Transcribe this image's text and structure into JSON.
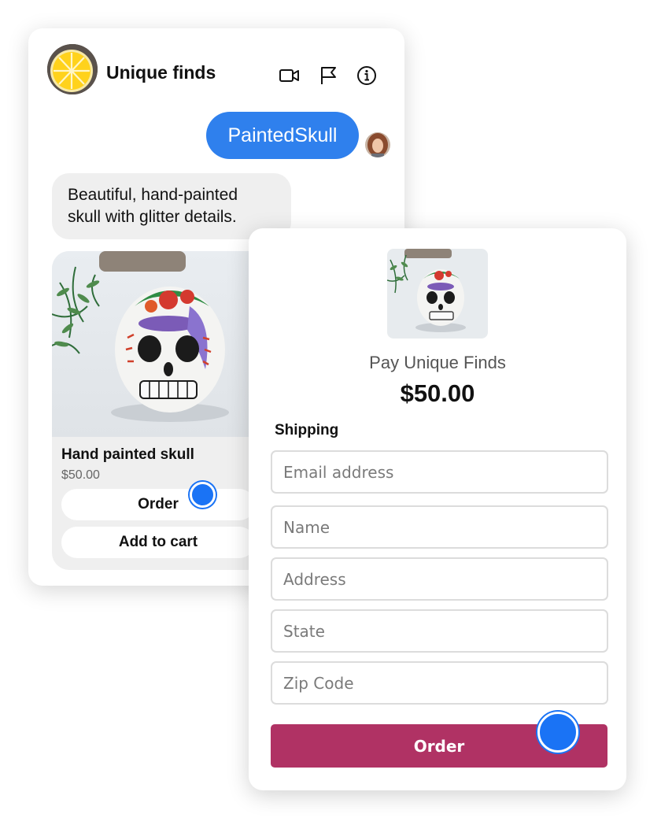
{
  "chat": {
    "shop_name": "Unique finds",
    "outgoing_message": "PaintedSkull",
    "incoming_message_line1": "Beautiful, hand-painted",
    "incoming_message_line2": "skull with glitter details.",
    "product": {
      "title": "Hand painted skull",
      "price": "$50.00",
      "order_label": "Order",
      "add_to_cart_label": "Add to cart"
    },
    "header_icons": [
      "video-call-icon",
      "flag-icon",
      "info-icon"
    ]
  },
  "checkout": {
    "merchant_line": "Pay Unique Finds",
    "amount": "$50.00",
    "section_label": "Shipping",
    "fields": {
      "email_placeholder": "Email address",
      "name_placeholder": "Name",
      "address_placeholder": "Address",
      "state_placeholder": "State",
      "zip_placeholder": "Zip Code"
    },
    "order_label": "Order"
  },
  "colors": {
    "outgoing_bubble": "#2f80ed",
    "incoming_bubble": "#efefef",
    "order_button": "#b03264",
    "tap_indicator": "#1a73f5"
  }
}
